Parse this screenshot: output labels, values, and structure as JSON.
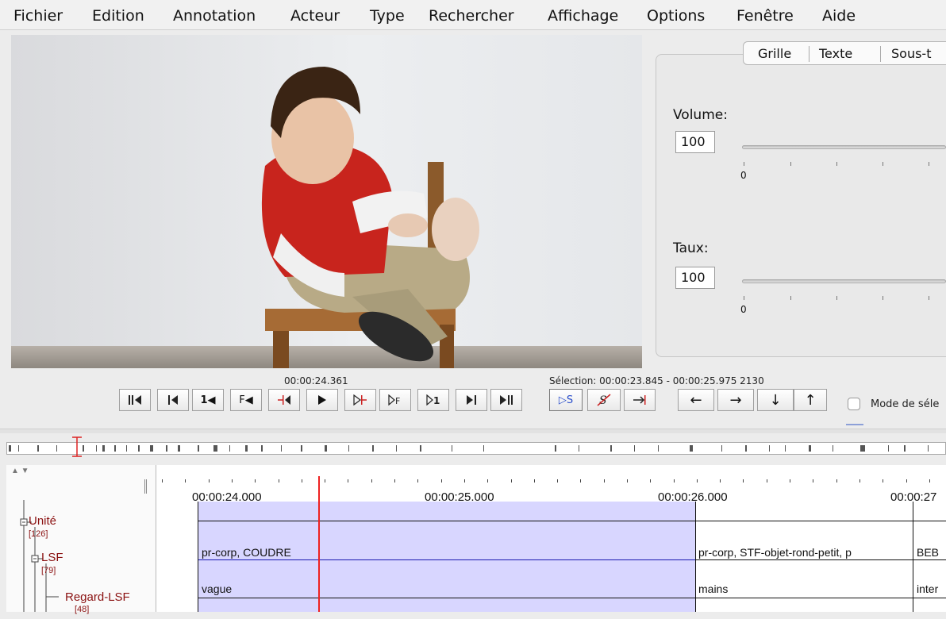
{
  "menu": [
    "Fichier",
    "Edition",
    "Annotation",
    "Acteur",
    "Type",
    "Rechercher",
    "Affichage",
    "Options",
    "Fenêtre",
    "Aide"
  ],
  "tabs": [
    "Grille",
    "Texte",
    "Sous-t"
  ],
  "volume": {
    "label": "Volume:",
    "value": "100",
    "min": "0"
  },
  "rate": {
    "label": "Taux:",
    "value": "100",
    "min": "0"
  },
  "media_time": "00:00:24.361",
  "selection": "Sélection: 00:00:23.845 - 00:00:25.975  2130",
  "controls": {
    "b1": "",
    "b3": "1◀",
    "b4": "F◀",
    "b11": "▷S",
    "b12": "S",
    "b14": "←",
    "b15": "→",
    "b16": "↓",
    "b17": "↑"
  },
  "selection_mode_label": "Mode de séle",
  "ruler": {
    "t1": "00:00:24.000",
    "t2": "00:00:25.000",
    "t3": "00:00:26.000",
    "t4": "00:00:27"
  },
  "tiers": [
    {
      "name": "Unité",
      "count": "[126]"
    },
    {
      "name": "LSF",
      "count": "[79]"
    },
    {
      "name": "Regard-LSF",
      "count": "[48]"
    }
  ],
  "annotations": {
    "lsf_1": "pr-corp, COUDRE",
    "lsf_2": "pr-corp, STF-objet-rond-petit, p",
    "lsf_3": "BEB",
    "regard_1": "vague",
    "regard_2": "mains",
    "regard_3": "inter"
  },
  "colors": {
    "selection": "#d8d6ff",
    "crosshair": "#ee2222",
    "tier_name": "#8a1010"
  }
}
